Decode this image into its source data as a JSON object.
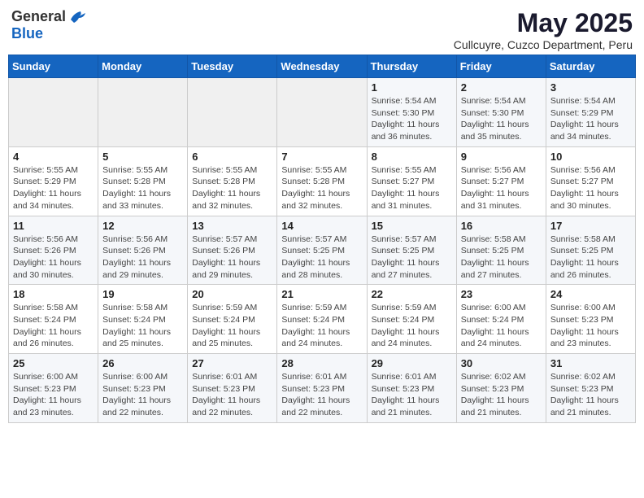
{
  "header": {
    "logo_line1": "General",
    "logo_line2": "Blue",
    "month_title": "May 2025",
    "subtitle": "Cullcuyre, Cuzco Department, Peru"
  },
  "weekdays": [
    "Sunday",
    "Monday",
    "Tuesday",
    "Wednesday",
    "Thursday",
    "Friday",
    "Saturday"
  ],
  "weeks": [
    [
      {
        "day": "",
        "info": ""
      },
      {
        "day": "",
        "info": ""
      },
      {
        "day": "",
        "info": ""
      },
      {
        "day": "",
        "info": ""
      },
      {
        "day": "1",
        "info": "Sunrise: 5:54 AM\nSunset: 5:30 PM\nDaylight: 11 hours\nand 36 minutes."
      },
      {
        "day": "2",
        "info": "Sunrise: 5:54 AM\nSunset: 5:30 PM\nDaylight: 11 hours\nand 35 minutes."
      },
      {
        "day": "3",
        "info": "Sunrise: 5:54 AM\nSunset: 5:29 PM\nDaylight: 11 hours\nand 34 minutes."
      }
    ],
    [
      {
        "day": "4",
        "info": "Sunrise: 5:55 AM\nSunset: 5:29 PM\nDaylight: 11 hours\nand 34 minutes."
      },
      {
        "day": "5",
        "info": "Sunrise: 5:55 AM\nSunset: 5:28 PM\nDaylight: 11 hours\nand 33 minutes."
      },
      {
        "day": "6",
        "info": "Sunrise: 5:55 AM\nSunset: 5:28 PM\nDaylight: 11 hours\nand 32 minutes."
      },
      {
        "day": "7",
        "info": "Sunrise: 5:55 AM\nSunset: 5:28 PM\nDaylight: 11 hours\nand 32 minutes."
      },
      {
        "day": "8",
        "info": "Sunrise: 5:55 AM\nSunset: 5:27 PM\nDaylight: 11 hours\nand 31 minutes."
      },
      {
        "day": "9",
        "info": "Sunrise: 5:56 AM\nSunset: 5:27 PM\nDaylight: 11 hours\nand 31 minutes."
      },
      {
        "day": "10",
        "info": "Sunrise: 5:56 AM\nSunset: 5:27 PM\nDaylight: 11 hours\nand 30 minutes."
      }
    ],
    [
      {
        "day": "11",
        "info": "Sunrise: 5:56 AM\nSunset: 5:26 PM\nDaylight: 11 hours\nand 30 minutes."
      },
      {
        "day": "12",
        "info": "Sunrise: 5:56 AM\nSunset: 5:26 PM\nDaylight: 11 hours\nand 29 minutes."
      },
      {
        "day": "13",
        "info": "Sunrise: 5:57 AM\nSunset: 5:26 PM\nDaylight: 11 hours\nand 29 minutes."
      },
      {
        "day": "14",
        "info": "Sunrise: 5:57 AM\nSunset: 5:25 PM\nDaylight: 11 hours\nand 28 minutes."
      },
      {
        "day": "15",
        "info": "Sunrise: 5:57 AM\nSunset: 5:25 PM\nDaylight: 11 hours\nand 27 minutes."
      },
      {
        "day": "16",
        "info": "Sunrise: 5:58 AM\nSunset: 5:25 PM\nDaylight: 11 hours\nand 27 minutes."
      },
      {
        "day": "17",
        "info": "Sunrise: 5:58 AM\nSunset: 5:25 PM\nDaylight: 11 hours\nand 26 minutes."
      }
    ],
    [
      {
        "day": "18",
        "info": "Sunrise: 5:58 AM\nSunset: 5:24 PM\nDaylight: 11 hours\nand 26 minutes."
      },
      {
        "day": "19",
        "info": "Sunrise: 5:58 AM\nSunset: 5:24 PM\nDaylight: 11 hours\nand 25 minutes."
      },
      {
        "day": "20",
        "info": "Sunrise: 5:59 AM\nSunset: 5:24 PM\nDaylight: 11 hours\nand 25 minutes."
      },
      {
        "day": "21",
        "info": "Sunrise: 5:59 AM\nSunset: 5:24 PM\nDaylight: 11 hours\nand 24 minutes."
      },
      {
        "day": "22",
        "info": "Sunrise: 5:59 AM\nSunset: 5:24 PM\nDaylight: 11 hours\nand 24 minutes."
      },
      {
        "day": "23",
        "info": "Sunrise: 6:00 AM\nSunset: 5:24 PM\nDaylight: 11 hours\nand 24 minutes."
      },
      {
        "day": "24",
        "info": "Sunrise: 6:00 AM\nSunset: 5:23 PM\nDaylight: 11 hours\nand 23 minutes."
      }
    ],
    [
      {
        "day": "25",
        "info": "Sunrise: 6:00 AM\nSunset: 5:23 PM\nDaylight: 11 hours\nand 23 minutes."
      },
      {
        "day": "26",
        "info": "Sunrise: 6:00 AM\nSunset: 5:23 PM\nDaylight: 11 hours\nand 22 minutes."
      },
      {
        "day": "27",
        "info": "Sunrise: 6:01 AM\nSunset: 5:23 PM\nDaylight: 11 hours\nand 22 minutes."
      },
      {
        "day": "28",
        "info": "Sunrise: 6:01 AM\nSunset: 5:23 PM\nDaylight: 11 hours\nand 22 minutes."
      },
      {
        "day": "29",
        "info": "Sunrise: 6:01 AM\nSunset: 5:23 PM\nDaylight: 11 hours\nand 21 minutes."
      },
      {
        "day": "30",
        "info": "Sunrise: 6:02 AM\nSunset: 5:23 PM\nDaylight: 11 hours\nand 21 minutes."
      },
      {
        "day": "31",
        "info": "Sunrise: 6:02 AM\nSunset: 5:23 PM\nDaylight: 11 hours\nand 21 minutes."
      }
    ]
  ]
}
